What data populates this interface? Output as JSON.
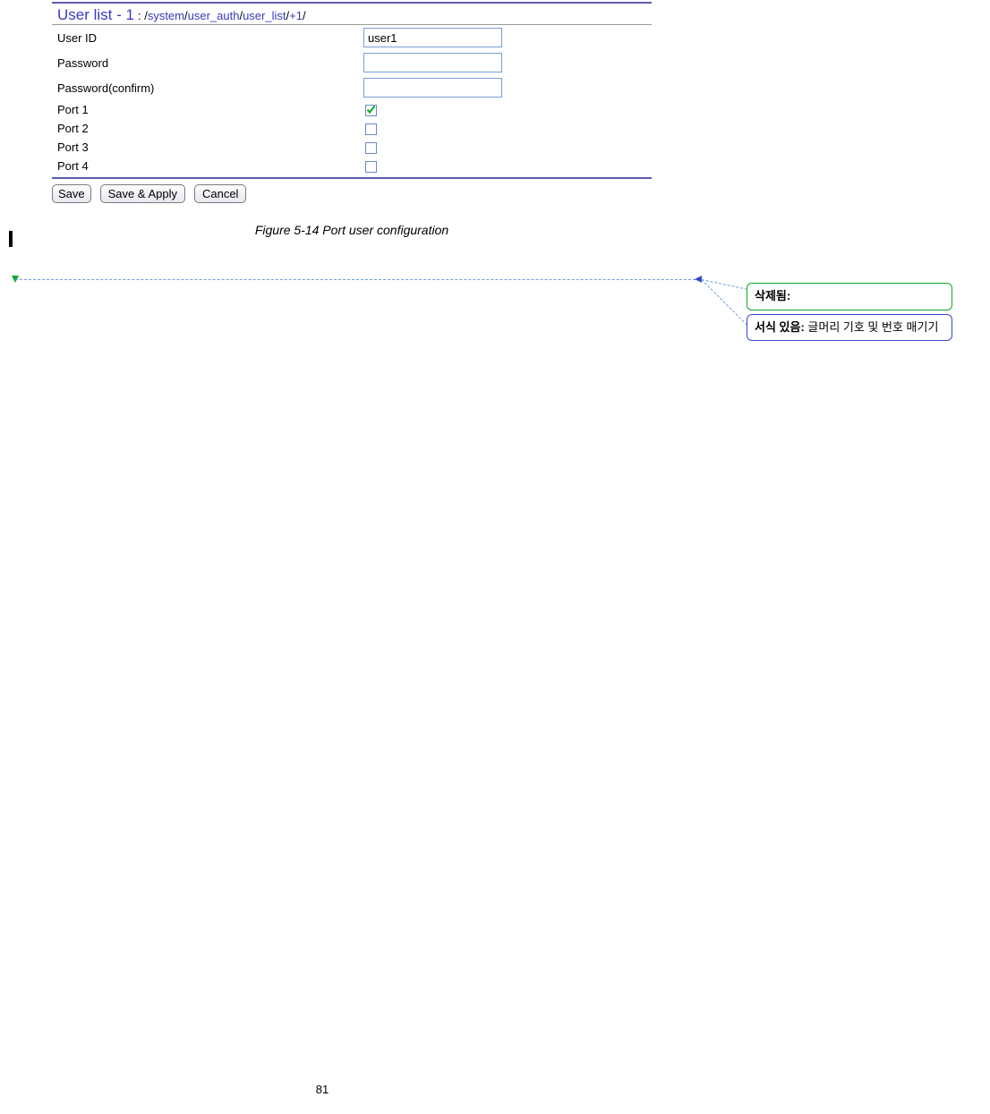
{
  "panel": {
    "title": "User list - 1",
    "breadcrumb_prefix": " : /",
    "breadcrumb_parts": [
      "system",
      "user_auth",
      "user_list",
      "+1"
    ],
    "fields": {
      "user_id": {
        "label": "User ID",
        "value": "user1"
      },
      "password": {
        "label": "Password",
        "value": ""
      },
      "password_confirm": {
        "label": "Password(confirm)",
        "value": ""
      },
      "port1": {
        "label": "Port 1",
        "checked": true
      },
      "port2": {
        "label": "Port 2",
        "checked": false
      },
      "port3": {
        "label": "Port 3",
        "checked": false
      },
      "port4": {
        "label": "Port 4",
        "checked": false
      }
    },
    "buttons": {
      "save": "Save",
      "save_apply": "Save & Apply",
      "cancel": "Cancel"
    }
  },
  "figure_caption": "Figure 5-14 Port user configuration",
  "comments": {
    "deleted_label": "삭제됨:",
    "deleted_text": " ",
    "format_label": "서식 있음:",
    "format_text": " 글머리 기호 및 번호 매기기"
  },
  "page_number": "81"
}
